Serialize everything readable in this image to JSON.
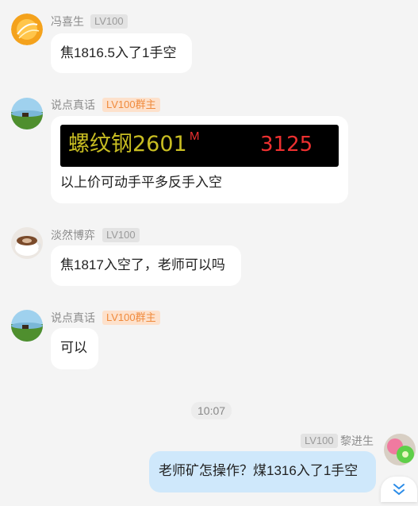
{
  "messages": [
    {
      "user": "冯喜生",
      "level": "LV100",
      "role": "",
      "text": "焦1816.5入了1手空"
    },
    {
      "user": "说点真话",
      "level": "LV100群主",
      "role": "群主",
      "ticker": {
        "name": "螺纹钢2601",
        "flag": "M",
        "price": "3125",
        "name_color": "#c8bd22",
        "price_color": "#ee3030"
      },
      "text": "以上价可动手平多反手入空"
    },
    {
      "user": "淡然博弈",
      "level": "LV100",
      "role": "",
      "text": "焦1817入空了，老师可以吗"
    },
    {
      "user": "说点真话",
      "level": "LV100群主",
      "role": "群主",
      "text": "可以"
    }
  ],
  "time_divider": "10:07",
  "self_message": {
    "user": "黎进生",
    "level": "LV100",
    "text": "老师矿怎操作？煤1316入了1手空"
  },
  "scroll_button": {
    "icon": "double-chevron-down-icon"
  },
  "colors": {
    "background": "#f4f4f4",
    "bubble": "#ffffff",
    "self_bubble": "#cfe8fb",
    "owner_badge": "#fde1cc",
    "owner_badge_text": "#f08a3c"
  }
}
